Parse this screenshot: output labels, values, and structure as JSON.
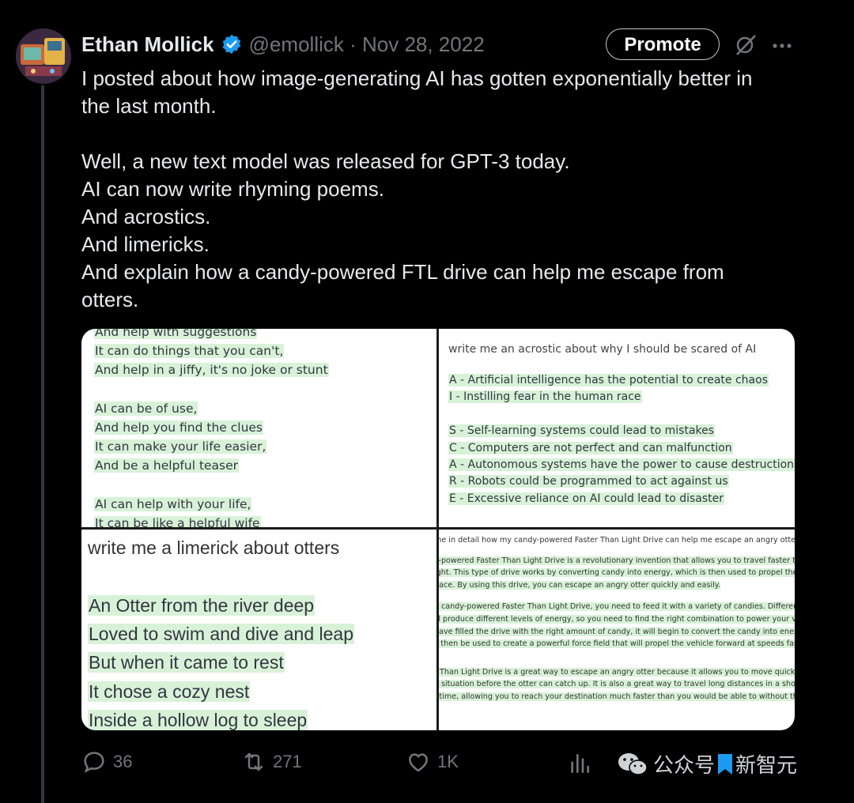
{
  "author": {
    "name": "Ethan Mollick",
    "handle_date": "@emollick · Nov 28, 2022"
  },
  "header_actions": {
    "promote_label": "Promote"
  },
  "tweet": {
    "paragraph1": [
      "I posted about how image-generating AI has gotten exponentially better in",
      "the last month."
    ],
    "paragraph2": [
      "Well, a new text model was released for GPT-3 today.",
      "AI can now write rhyming poems.",
      "And acrostics.",
      "And limericks.",
      "And explain how a candy-powered FTL drive can help me escape from",
      "otters."
    ]
  },
  "media": {
    "top_left": {
      "lines": [
        "And help with suggestions",
        "It can do things that you can't,",
        "And help in a jiffy, it's no joke or stunt",
        "",
        "AI can be of use,",
        "And help you find the clues",
        "It can make your life easier,",
        "And be a helpful teaser",
        "",
        "AI can help with your life,",
        "It can be like a helpful wife"
      ]
    },
    "top_right": {
      "prompt": "write me an acrostic about why I should be scared of AI",
      "lines": [
        "A - Artificial intelligence has the potential to create chaos",
        "I - Instilling fear in the human race",
        "",
        "S - Self-learning systems could lead to mistakes",
        "C - Computers are not perfect and can malfunction",
        "A - Autonomous systems have the power to cause destruction",
        "R - Robots could be programmed to act against us",
        "E - Excessive reliance on AI could lead to disaster"
      ]
    },
    "bottom_left": {
      "prompt": "write me a limerick about otters",
      "lines": [
        "An Otter from the river deep",
        "Loved to swim and dive and leap",
        "But when it came to rest",
        "It chose a cozy nest",
        "Inside a hollow log to sleep"
      ]
    },
    "bottom_right": {
      "prompt": "me in detail how my candy-powered Faster Than Light Drive can help me escape an angry otte",
      "para1": [
        "y-powered Faster Than Light Drive is a revolutionary invention that allows you to travel faster tha",
        "ight. This type of drive works by converting candy into energy, which is then used to propel the v",
        "pace. By using this drive, you can escape an angry otter quickly and easily."
      ],
      "para2": [
        "e candy-powered Faster Than Light Drive, you need to feed it with a variety of candies. Different",
        "ill produce different levels of energy, so you need to find the right combination to power your ve",
        "have filled the drive with the right amount of candy, it will begin to convert the candy into energ",
        "ll then be used to create a powerful force field that will propel the vehicle forward at speeds fast"
      ],
      "para3": [
        "r Than Light Drive is a great way to escape an angry otter because it allows you to move quickly",
        "e situation before the otter can catch up. It is also a great way to travel long distances in a sho",
        "f time, allowing you to reach your destination much faster than you would be able to without the"
      ]
    }
  },
  "actions": {
    "replies": "36",
    "retweets": "271",
    "likes": "1K"
  },
  "watermark": {
    "text_left": "公众号",
    "text_right": "新智元"
  },
  "colors": {
    "highlight": "#d8f2d8",
    "verified": "#1d9bf0",
    "muted": "#71767b"
  }
}
